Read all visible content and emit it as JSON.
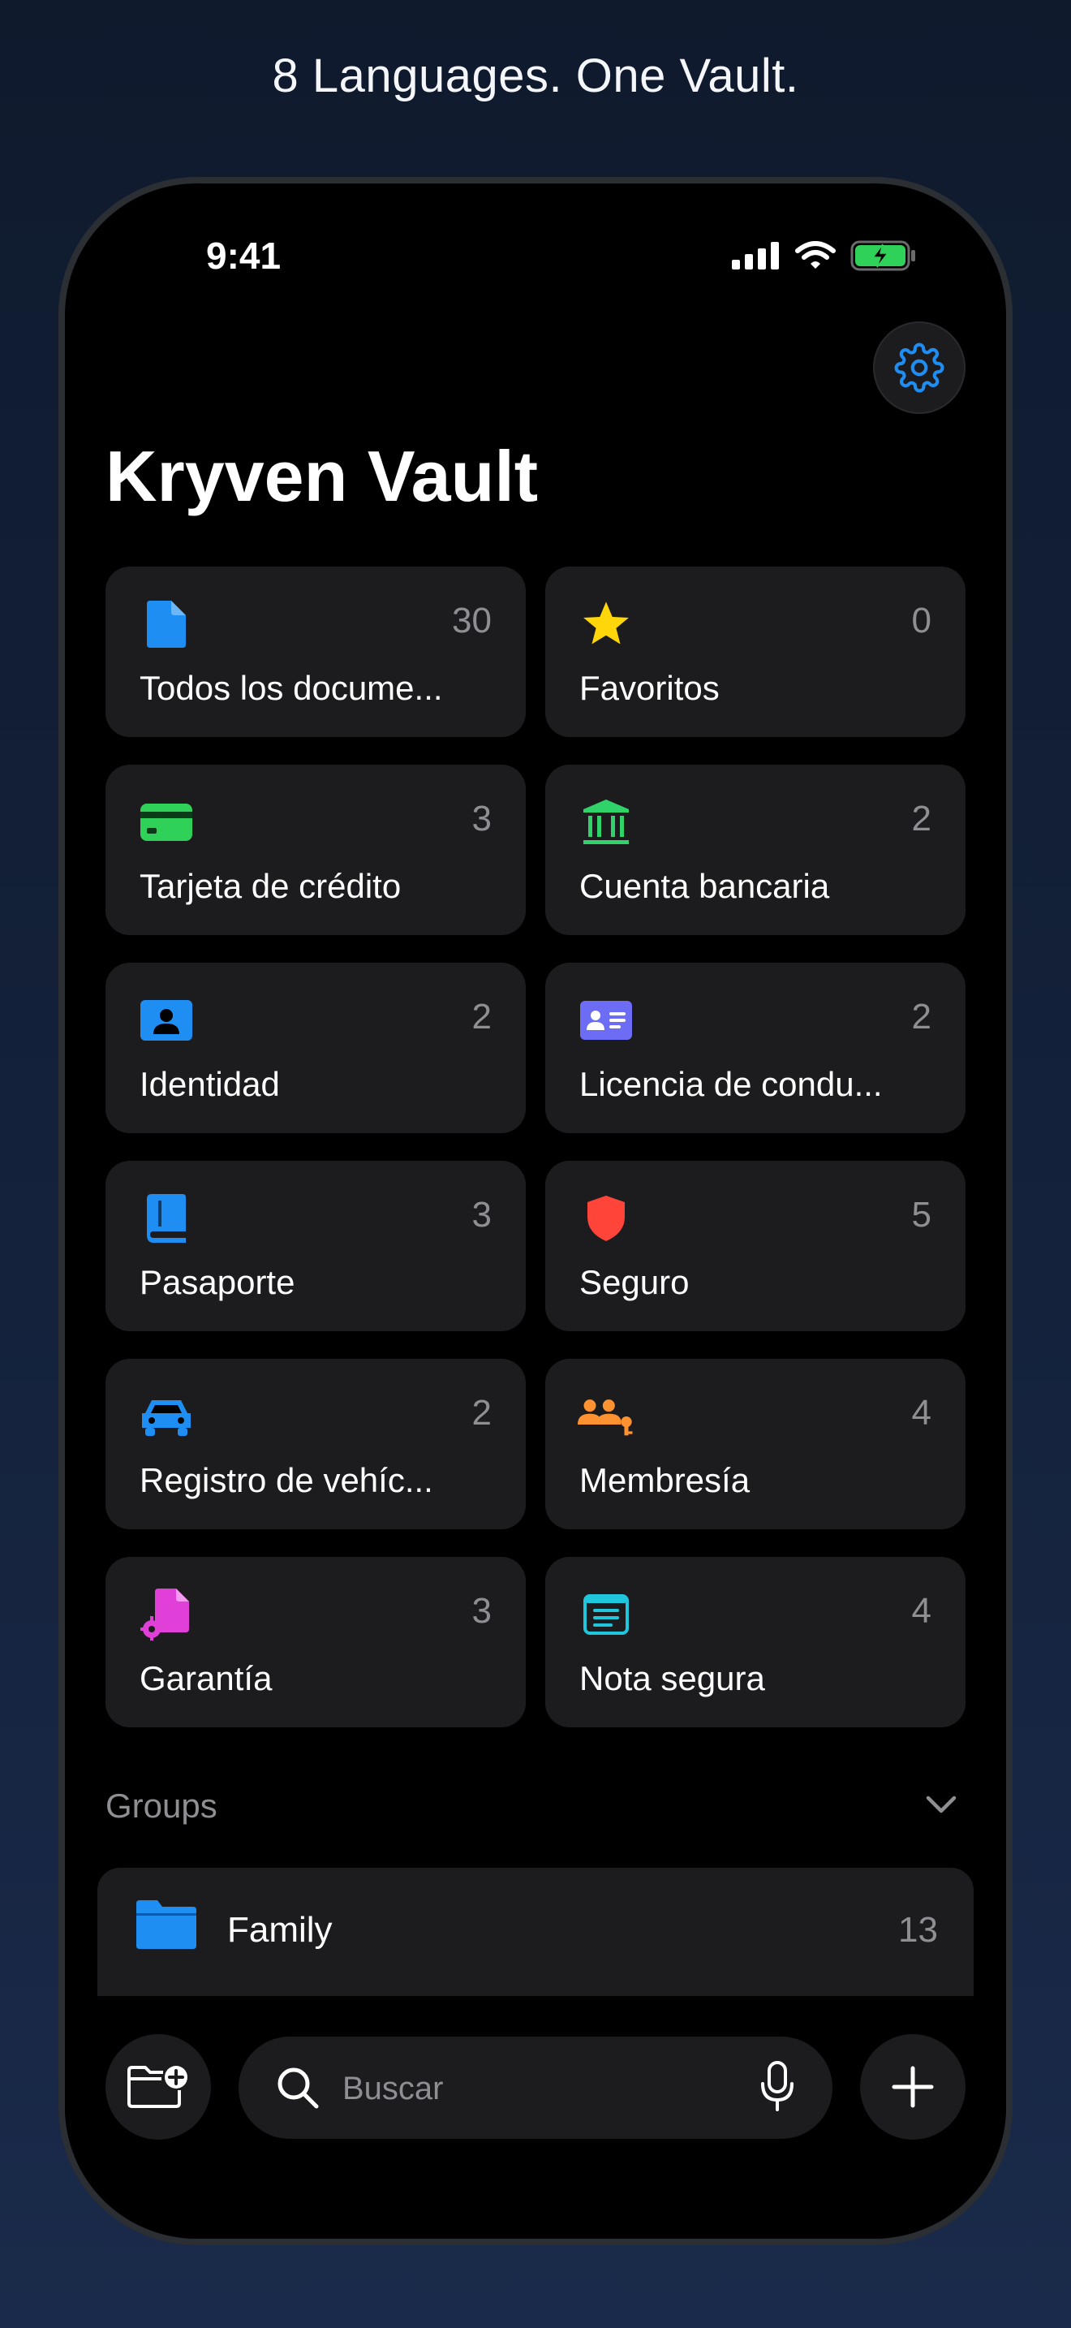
{
  "tagline": "8 Languages. One Vault.",
  "status": {
    "time": "9:41"
  },
  "app": {
    "title": "Kryven Vault"
  },
  "categories": [
    {
      "label": "Todos los docume...",
      "count": "30",
      "icon": "document-icon",
      "color": "#1e8ef2"
    },
    {
      "label": "Favoritos",
      "count": "0",
      "icon": "star-icon",
      "color": "#ffd60a"
    },
    {
      "label": "Tarjeta de crédito",
      "count": "3",
      "icon": "credit-card-icon",
      "color": "#30d158"
    },
    {
      "label": "Cuenta bancaria",
      "count": "2",
      "icon": "bank-icon",
      "color": "#2fd36a"
    },
    {
      "label": "Identidad",
      "count": "2",
      "icon": "person-card-icon",
      "color": "#1e8ef2"
    },
    {
      "label": "Licencia de condu...",
      "count": "2",
      "icon": "id-card-icon",
      "color": "#6c6cf5"
    },
    {
      "label": "Pasaporte",
      "count": "3",
      "icon": "book-icon",
      "color": "#1e8ef2"
    },
    {
      "label": "Seguro",
      "count": "5",
      "icon": "shield-icon",
      "color": "#ff453a"
    },
    {
      "label": "Registro de vehíc...",
      "count": "2",
      "icon": "car-icon",
      "color": "#1e8ef2"
    },
    {
      "label": "Membresía",
      "count": "4",
      "icon": "people-key-icon",
      "color": "#ff9230"
    },
    {
      "label": "Garantía",
      "count": "3",
      "icon": "doc-gear-icon",
      "color": "#e040d8"
    },
    {
      "label": "Nota segura",
      "count": "4",
      "icon": "note-icon",
      "color": "#20c6dc"
    }
  ],
  "groups": {
    "header": "Groups",
    "items": [
      {
        "label": "Family",
        "count": "13",
        "icon": "folder-icon",
        "color": "#1e8ef2"
      }
    ]
  },
  "search": {
    "placeholder": "Buscar"
  },
  "colors": {
    "accent": "#1e8ef2",
    "card": "#1c1c1e",
    "secondary_text": "#8e8e93"
  }
}
